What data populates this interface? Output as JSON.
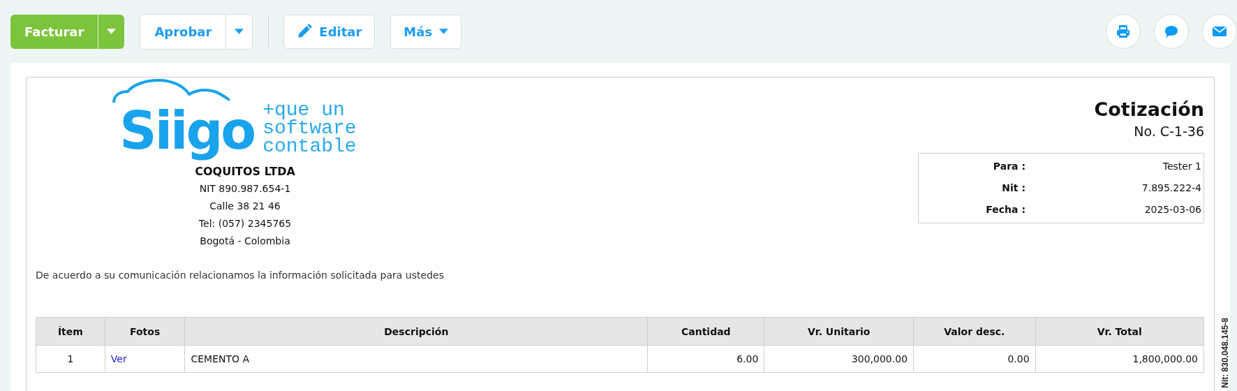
{
  "toolbar": {
    "buttons": [
      {
        "label": "Facturar",
        "kind": "split-primary"
      },
      {
        "label": "Aprobar",
        "kind": "split"
      },
      {
        "label": "Editar",
        "kind": "edit"
      },
      {
        "label": "Más",
        "kind": "menu"
      }
    ],
    "round_buttons": [
      {
        "kind": "print"
      },
      {
        "kind": "comment"
      },
      {
        "kind": "mail"
      }
    ]
  },
  "logo": {
    "brand": "Siigo",
    "tagline": [
      "+que un",
      "software",
      "contable"
    ]
  },
  "company": {
    "name": "COQUITOS LTDA",
    "lines": [
      "NIT 890.987.654-1",
      "Calle 38 21 46",
      "Tel: (057) 2345765",
      "Bogotá - Colombia"
    ]
  },
  "document": {
    "title": "Cotización",
    "number": "No. C-1-36",
    "details": [
      {
        "label": "Para :",
        "value": "Tester 1"
      },
      {
        "label": "Nit :",
        "value": "7.895.222-4"
      },
      {
        "label": "Fecha :",
        "value": "2025-03-06"
      }
    ]
  },
  "intro": "De acuerdo a su comunicación relacionamos la información solicitada para ustedes",
  "table": {
    "columns": [
      "Ítem",
      "Fotos",
      "Descripción",
      "Cantidad",
      "Vr. Unitario",
      "Valor desc.",
      "Vr. Total"
    ],
    "rows": [
      {
        "cells": [
          {
            "text": "1",
            "kind": "text"
          },
          {
            "text": "Ver",
            "kind": "link"
          },
          {
            "text": "CEMENTO A",
            "kind": "text"
          },
          {
            "text": "6.00",
            "kind": "text"
          },
          {
            "text": "300,000.00",
            "kind": "text"
          },
          {
            "text": "0.00",
            "kind": "text"
          },
          {
            "text": "1,800,000.00",
            "kind": "text"
          }
        ]
      }
    ]
  },
  "side_note": "Nit: 830.048.145-8"
}
